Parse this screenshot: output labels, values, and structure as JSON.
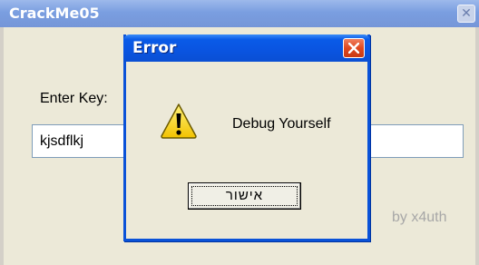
{
  "main_window": {
    "title": "CrackMe05",
    "close_symbol": "✕",
    "label": "Enter Key:",
    "input_value": "kjsdflkj",
    "credit": "by x4uth"
  },
  "dialog": {
    "title": "Error",
    "message": "Debug Yourself",
    "ok_label": "אישור",
    "icon": "warning-icon"
  },
  "colors": {
    "dialog_title_blue": "#0a54e0",
    "close_red": "#e0481f",
    "window_bg": "#ece9d8",
    "inactive_title": "#7a9ee0"
  }
}
